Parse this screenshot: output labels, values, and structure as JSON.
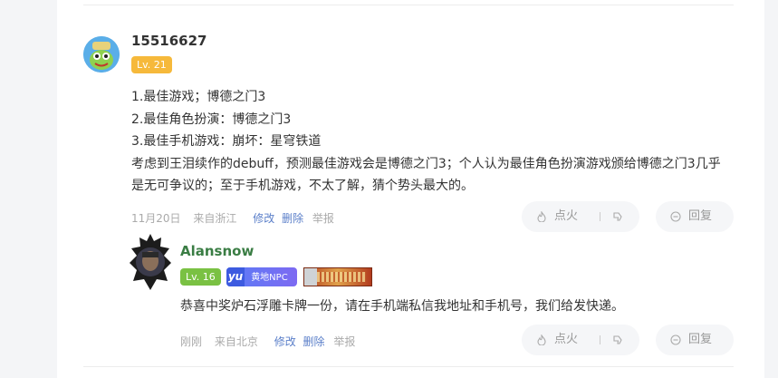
{
  "comment": {
    "username": "15516627",
    "level": "Lv. 21",
    "lines": [
      "1.最佳游戏；博德之门3",
      "2.最佳角色扮演：博德之门3",
      "3.最佳手机游戏：崩坏：星穹铁道",
      "考虑到王泪续作的debuff，预测最佳游戏会是博德之门3；个人认为最佳角色扮演游戏颁给博德之门3几乎是无可争议的；至于手机游戏，不太了解，猜个势头最大的。"
    ],
    "date": "11月20日",
    "location": "来自浙江",
    "edit_label": "修改",
    "delete_label": "删除",
    "report_label": "举报",
    "fire_label": "点火",
    "reply_label": "回复"
  },
  "reply": {
    "username": "Alansnow",
    "level": "Lv. 16",
    "badge_yu": "yu",
    "badge_text": "黄地NPC",
    "text": "恭喜中奖炉石浮雕卡牌一份，请在手机端私信我地址和手机号，我们给发快递。",
    "date": "刚刚",
    "location": "来自北京",
    "edit_label": "修改",
    "delete_label": "删除",
    "report_label": "举报",
    "fire_label": "点火",
    "reply_label": "回复"
  },
  "colors": {
    "accent_link": "#5b7fc9",
    "level_gold": "#f6b93b",
    "level_green": "#7ac143",
    "reply_name": "#3a7d44"
  },
  "icons": [
    "fire-icon",
    "thumb-down-icon",
    "comment-icon"
  ]
}
